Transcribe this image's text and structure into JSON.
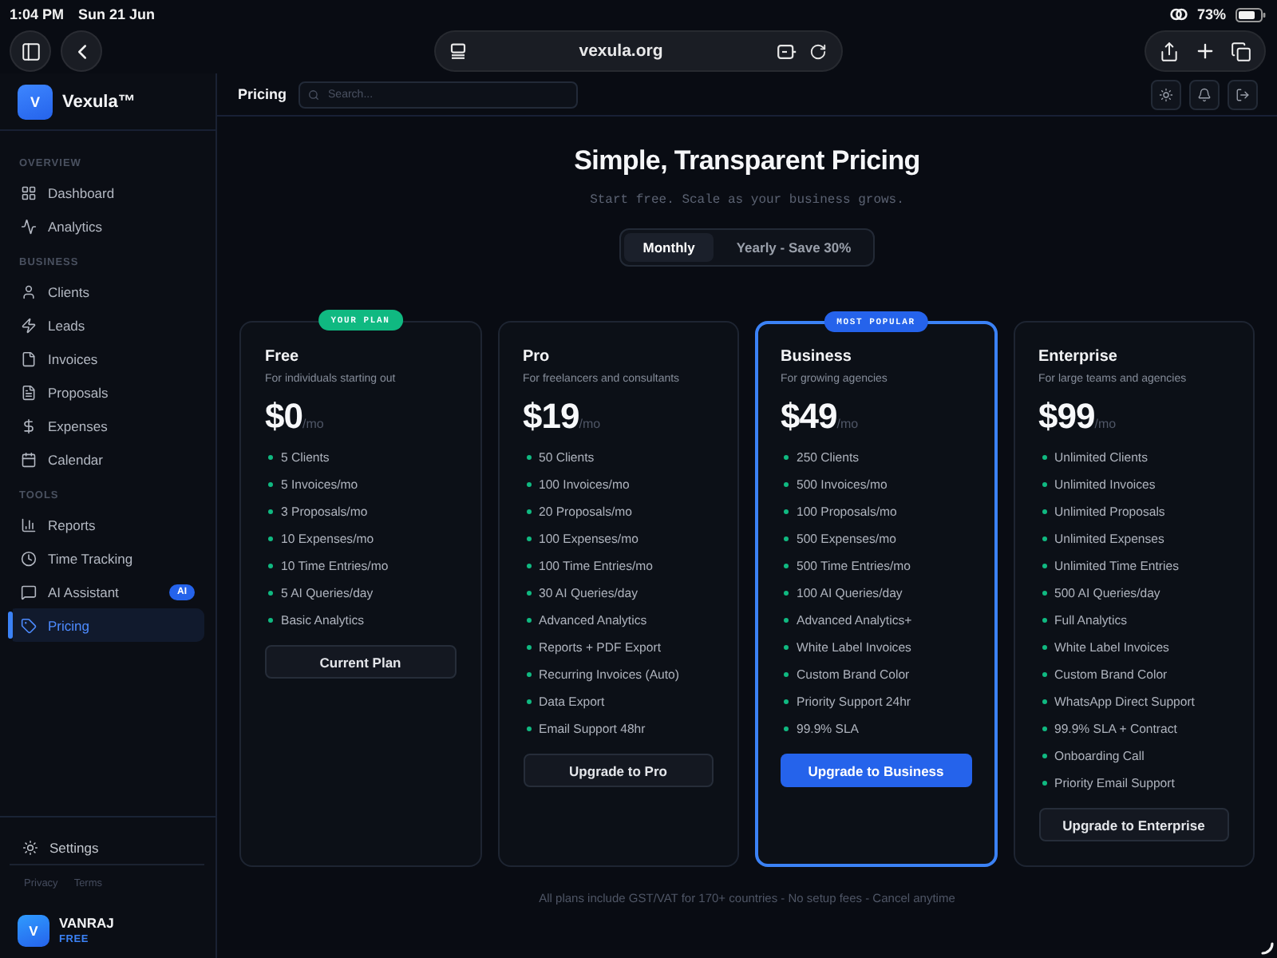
{
  "status_bar": {
    "time": "1:04 PM",
    "date": "Sun 21 Jun",
    "battery": "73%"
  },
  "browser": {
    "url": "vexula.org"
  },
  "sidebar": {
    "logo_letter": "V",
    "brand": "Vexula™",
    "sections": [
      {
        "heading": "OVERVIEW",
        "items": [
          {
            "label": "Dashboard",
            "selected": false
          },
          {
            "label": "Analytics",
            "selected": false
          }
        ]
      },
      {
        "heading": "BUSINESS",
        "items": [
          {
            "label": "Clients",
            "selected": false
          },
          {
            "label": "Leads",
            "selected": false
          },
          {
            "label": "Invoices",
            "selected": false
          },
          {
            "label": "Proposals",
            "selected": false
          },
          {
            "label": "Expenses",
            "selected": false
          },
          {
            "label": "Calendar",
            "selected": false
          }
        ]
      },
      {
        "heading": "TOOLS",
        "items": [
          {
            "label": "Reports",
            "selected": false
          },
          {
            "label": "Time Tracking",
            "selected": false
          },
          {
            "label": "AI Assistant",
            "selected": false,
            "badge": "AI"
          },
          {
            "label": "Pricing",
            "selected": true
          }
        ]
      }
    ],
    "settings": "Settings",
    "links": [
      "Privacy",
      "Terms"
    ],
    "user": {
      "initial": "V",
      "name": "VANRAJ",
      "plan": "FREE"
    }
  },
  "header": {
    "title": "Pricing",
    "search": {
      "placeholder": "Search..."
    }
  },
  "pricing": {
    "title": "Simple, Transparent Pricing",
    "subtitle": "Start free. Scale as your business grows.",
    "billing": [
      {
        "label": "Monthly",
        "selected": true
      },
      {
        "label": "Yearly - Save 30%",
        "selected": false
      }
    ],
    "plans": [
      {
        "name": "Free",
        "description": "For individuals starting out",
        "price": "$0",
        "period": "/mo",
        "badge": {
          "text": "YOUR PLAN",
          "color": "#10b981"
        },
        "highlighted": false,
        "features": [
          "5 Clients",
          "5 Invoices/mo",
          "3 Proposals/mo",
          "10 Expenses/mo",
          "10 Time Entries/mo",
          "5 AI Queries/day",
          "Basic Analytics"
        ],
        "button": "Current Plan"
      },
      {
        "name": "Pro",
        "description": "For freelancers and consultants",
        "price": "$19",
        "period": "/mo",
        "highlighted": false,
        "features": [
          "50 Clients",
          "100 Invoices/mo",
          "20 Proposals/mo",
          "100 Expenses/mo",
          "100 Time Entries/mo",
          "30 AI Queries/day",
          "Advanced Analytics",
          "Reports + PDF Export",
          "Recurring Invoices (Auto)",
          "Data Export",
          "Email Support 48hr"
        ],
        "button": "Upgrade to Pro"
      },
      {
        "name": "Business",
        "description": "For growing agencies",
        "price": "$49",
        "period": "/mo",
        "badge": {
          "text": "MOST POPULAR",
          "color": "#2563eb"
        },
        "highlighted": true,
        "features": [
          "250 Clients",
          "500 Invoices/mo",
          "100 Proposals/mo",
          "500 Expenses/mo",
          "500 Time Entries/mo",
          "100 AI Queries/day",
          "Advanced Analytics+",
          "White Label Invoices",
          "Custom Brand Color",
          "Priority Support 24hr",
          "99.9% SLA"
        ],
        "button": "Upgrade to Business"
      },
      {
        "name": "Enterprise",
        "description": "For large teams and agencies",
        "price": "$99",
        "period": "/mo",
        "highlighted": false,
        "features": [
          "Unlimited Clients",
          "Unlimited Invoices",
          "Unlimited Proposals",
          "Unlimited Expenses",
          "Unlimited Time Entries",
          "500 AI Queries/day",
          "Full Analytics",
          "White Label Invoices",
          "Custom Brand Color",
          "WhatsApp Direct Support",
          "99.9% SLA + Contract",
          "Onboarding Call",
          "Priority Email Support"
        ],
        "button": "Upgrade to Enterprise"
      }
    ],
    "footnote": "All plans include GST/VAT for 170+ countries - No setup fees - Cancel anytime"
  }
}
